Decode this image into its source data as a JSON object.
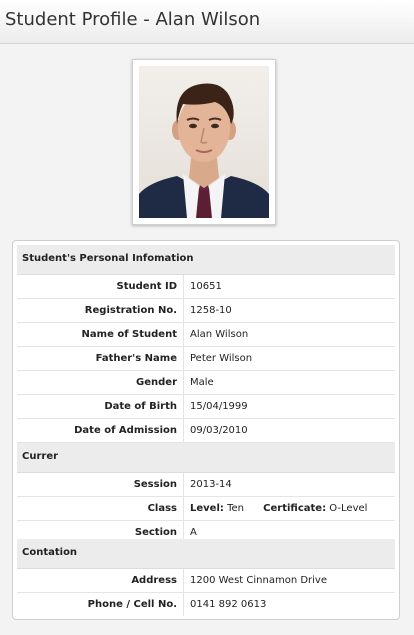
{
  "page": {
    "title": "Student Profile - Alan Wilson"
  },
  "photo": {
    "icon": "student-photo"
  },
  "sections": {
    "personal": {
      "heading": "Student's Personal Infomation",
      "rows": [
        {
          "label": "Student ID",
          "value": "10651"
        },
        {
          "label": "Registration No.",
          "value": "1258-10"
        },
        {
          "label": "Name of Student",
          "value": "Alan Wilson"
        },
        {
          "label": "Father's Name",
          "value": "Peter Wilson"
        },
        {
          "label": "Gender",
          "value": "Male"
        },
        {
          "label": "Date of Birth",
          "value": "15/04/1999"
        },
        {
          "label": "Date of Admission",
          "value": "09/03/2010"
        }
      ]
    },
    "current": {
      "heading": "Currer",
      "session_label": "Session",
      "session_value": "2013-14",
      "class_label": "Class",
      "level_label": "Level:",
      "level_value": "Ten",
      "certificate_label": "Certificate:",
      "certificate_value": "O-Level",
      "section_label": "Section",
      "section_value": "A"
    },
    "contact": {
      "heading": "Contation",
      "rows": [
        {
          "label": "Address",
          "value": "1200 West Cinnamon Drive"
        },
        {
          "label": "Phone / Cell No.",
          "value": "0141 892 0613"
        }
      ]
    }
  }
}
